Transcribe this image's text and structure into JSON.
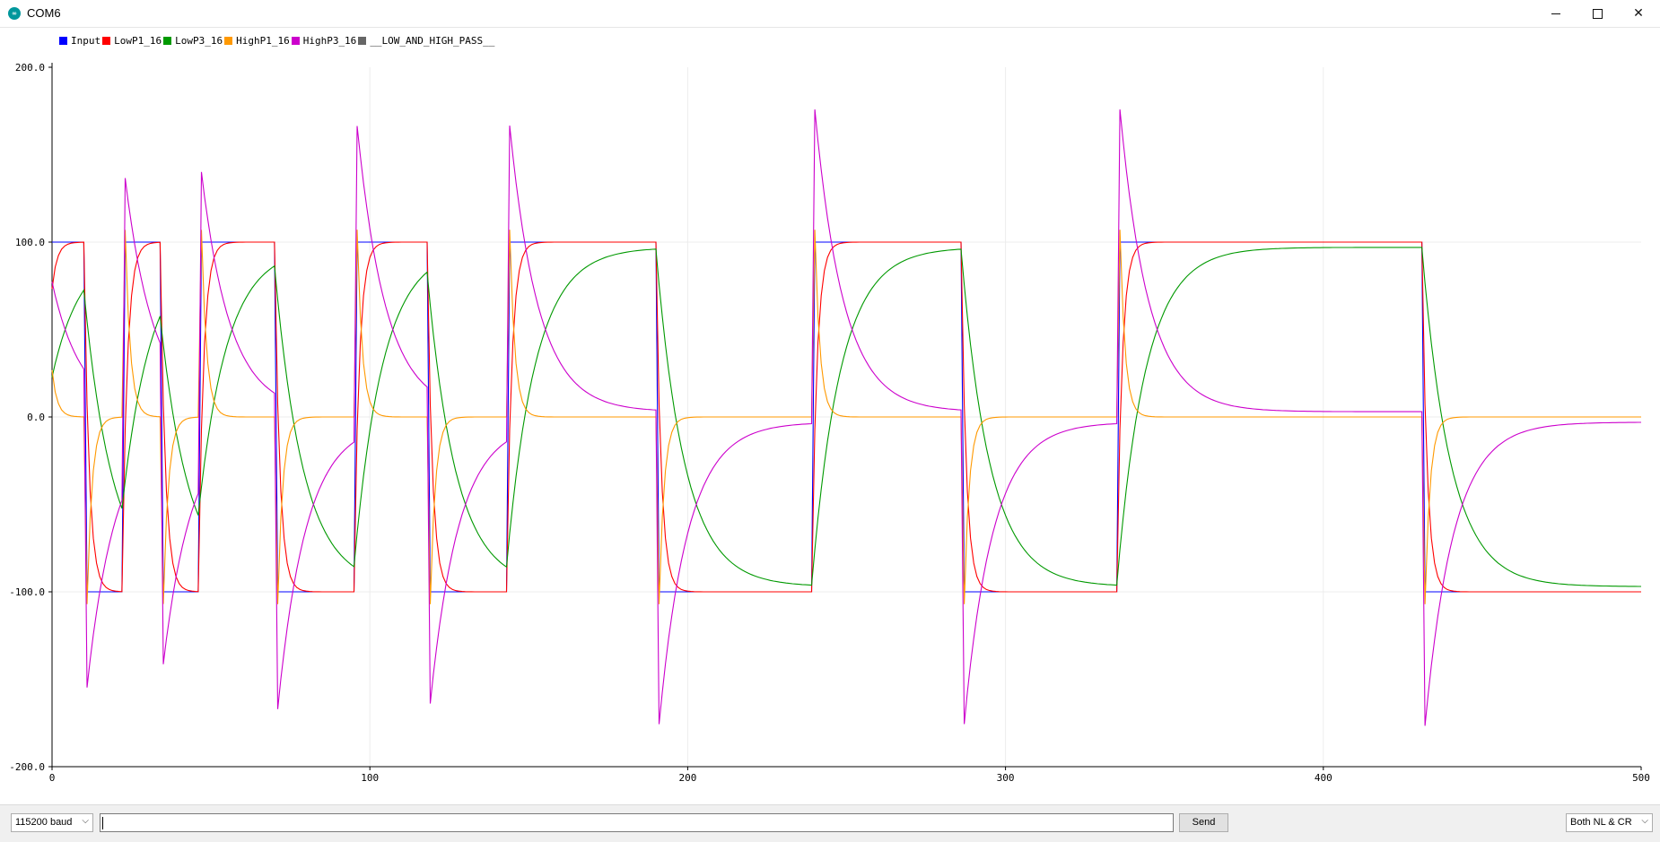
{
  "window": {
    "title": "COM6",
    "icon": "arduino-icon",
    "controls": [
      "minimize-icon",
      "maximize-icon",
      "close-icon"
    ]
  },
  "legend": [
    {
      "label": "Input",
      "color": "#0000ff"
    },
    {
      "label": "LowP1_16",
      "color": "#ff0000"
    },
    {
      "label": "LowP3_16",
      "color": "#009900"
    },
    {
      "label": "HighP1_16",
      "color": "#ff9900"
    },
    {
      "label": "HighP3_16",
      "color": "#cc00cc"
    },
    {
      "label": "__LOW_AND_HIGH_PASS__",
      "color": "#666666"
    }
  ],
  "bottom": {
    "baud": "115200 baud",
    "send": "Send",
    "line_ending": "Both NL & CR",
    "input_value": ""
  },
  "chart_data": {
    "type": "line",
    "xlim": [
      0,
      500
    ],
    "ylim": [
      -200,
      200
    ],
    "xticks": [
      "0",
      "100",
      "200",
      "300",
      "400",
      "500"
    ],
    "yticks": [
      "200.0",
      "100.0",
      "0.0",
      "-100.0",
      "-200.0"
    ],
    "grid": true,
    "legend_position": "top-left",
    "input_transitions": [
      {
        "x": 0,
        "y": 100
      },
      {
        "x": 11,
        "y": -100
      },
      {
        "x": 23,
        "y": 100
      },
      {
        "x": 35,
        "y": -100
      },
      {
        "x": 47,
        "y": 100
      },
      {
        "x": 71,
        "y": -100
      },
      {
        "x": 96,
        "y": 100
      },
      {
        "x": 119,
        "y": -100
      },
      {
        "x": 144,
        "y": 100
      },
      {
        "x": 191,
        "y": -100
      },
      {
        "x": 240,
        "y": 100
      },
      {
        "x": 287,
        "y": -100
      },
      {
        "x": 336,
        "y": 100
      },
      {
        "x": 432,
        "y": -100
      },
      {
        "x": 500,
        "y": -100
      }
    ],
    "series": [
      {
        "name": "Input",
        "color": "#0000ff",
        "model": "square"
      },
      {
        "name": "LowP1_16",
        "color": "#ff0000",
        "model": "lowpass",
        "tau": 1.6
      },
      {
        "name": "LowP3_16",
        "color": "#009900",
        "model": "lowpass3",
        "tau": 9,
        "peak": 97
      },
      {
        "name": "HighP1_16",
        "color": "#ff9900",
        "model": "highpass",
        "tau": 1.6
      },
      {
        "name": "HighP3_16",
        "color": "#cc00cc",
        "model": "highpass3",
        "tau": 9,
        "offset": 3
      }
    ]
  }
}
